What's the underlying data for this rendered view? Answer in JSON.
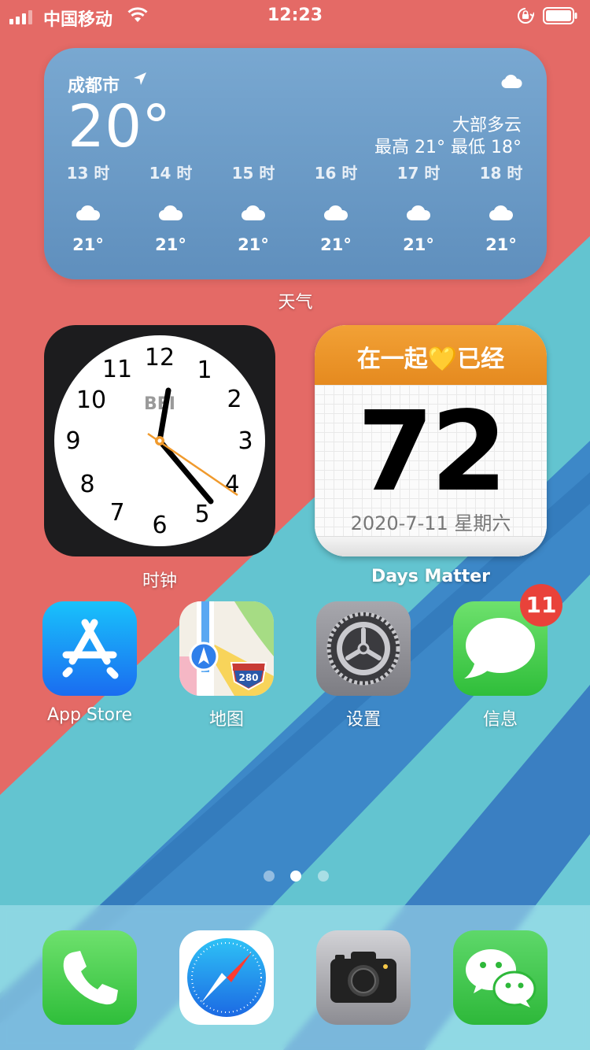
{
  "status_bar": {
    "carrier": "中国移动",
    "time": "12:23"
  },
  "weather": {
    "city": "成都市",
    "temperature": "20°",
    "condition": "大部多云",
    "high": "最高 21°",
    "low": "最低 18°",
    "hourly": [
      {
        "time": "13 时",
        "temp": "21°",
        "icon": "cloud-icon"
      },
      {
        "time": "14 时",
        "temp": "21°",
        "icon": "cloud-icon"
      },
      {
        "time": "15 时",
        "temp": "21°",
        "icon": "cloud-icon"
      },
      {
        "time": "16 时",
        "temp": "21°",
        "icon": "cloud-icon"
      },
      {
        "time": "17 时",
        "temp": "21°",
        "icon": "cloud-icon"
      },
      {
        "time": "18 时",
        "temp": "21°",
        "icon": "cloud-icon"
      }
    ],
    "label": "天气"
  },
  "clock": {
    "label": "时钟",
    "city_code": "BEI",
    "numbers": [
      "12",
      "1",
      "2",
      "3",
      "4",
      "5",
      "6",
      "7",
      "8",
      "9",
      "10",
      "11"
    ]
  },
  "days_matter": {
    "title": "在一起💛已经",
    "days": "72",
    "date": "2020-7-11 星期六",
    "label": "Days Matter"
  },
  "apps": [
    {
      "name": "App Store",
      "icon": "app-store-icon"
    },
    {
      "name": "地图",
      "icon": "maps-icon"
    },
    {
      "name": "设置",
      "icon": "settings-icon"
    },
    {
      "name": "信息",
      "icon": "messages-icon",
      "badge": "11"
    }
  ],
  "maps_sign": "280",
  "page_dots": {
    "count": 3,
    "active": 2
  },
  "dock": [
    {
      "icon": "phone-icon"
    },
    {
      "icon": "safari-icon"
    },
    {
      "icon": "camera-icon"
    },
    {
      "icon": "wechat-icon"
    }
  ],
  "colors": {
    "weather_bg": "#6a9acb",
    "badge": "#e9423a",
    "days_matter_header": "#ec9428"
  }
}
